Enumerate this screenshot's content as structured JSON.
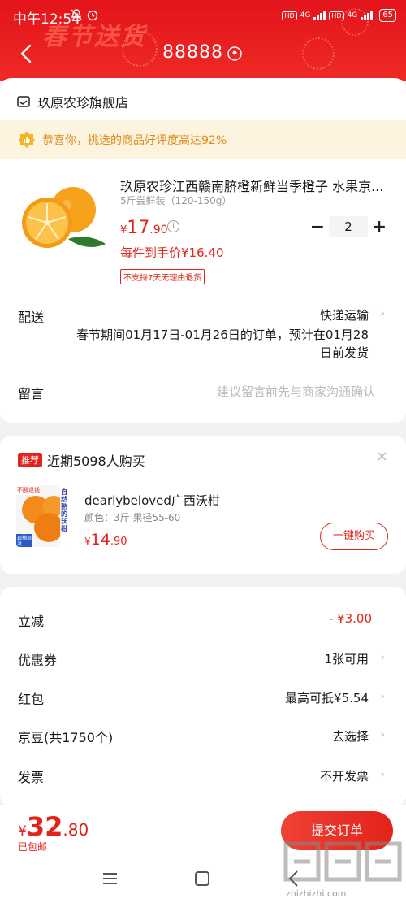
{
  "status_bar": {
    "time": "中午12:54",
    "battery": "65",
    "network": "4G"
  },
  "header": {
    "festival_text": "春节送货",
    "title": "88888"
  },
  "shop": {
    "name": "玖原农珍旗舰店"
  },
  "banner": {
    "text": "恭喜你，挑选的商品好评度高达92%"
  },
  "product": {
    "title": "玖原农珍江西赣南脐橙新鲜当季橙子 水果京...",
    "spec": "5斤尝鲜装（120-150g）",
    "price_currency": "¥",
    "price_int": "17",
    "price_dec": ".90",
    "quantity": "2",
    "unit_price": "每件到手价¥16.40",
    "no_return": "不支持7天无理由退货"
  },
  "delivery": {
    "label": "配送",
    "value": "快递运输",
    "note_line1": "春节期间01月17日-01月26日的订单，预计在01月28",
    "note_line2": "日前发货"
  },
  "remark": {
    "label": "留言",
    "placeholder": "建议留言前先与商家沟通确认"
  },
  "recommend": {
    "badge": "推荐",
    "title": "近期5098人购买",
    "item_name": "dearlybeloved广西沃柑",
    "item_spec": "颜色：3斤  果径55-60",
    "price_currency": "¥",
    "price_int": "14",
    "price_dec": ".90",
    "buy_label": "一键购买",
    "image_text_top": "不酸退钱",
    "image_text_side": "自然熟的沃柑",
    "image_text_bottom": "现摘现发"
  },
  "summary": [
    {
      "label": "立减",
      "value": "- ¥3.00"
    },
    {
      "label": "优惠券",
      "value": "1张可用"
    },
    {
      "label": "红包",
      "value": "最高可抵¥5.54"
    },
    {
      "label": "京豆(共1750个)",
      "value": "去选择"
    },
    {
      "label": "发票",
      "value": "不开发票"
    }
  ],
  "footer": {
    "total_currency": "¥",
    "total_int": "32",
    "total_dec": ".80",
    "shipping": "已包邮",
    "submit_label": "提交订单"
  },
  "watermark": {
    "text": "zhizhizhi.com"
  },
  "colors": {
    "brand_red": "#e2231a",
    "banner_bg": "#fdf4df",
    "banner_text": "#e08a19"
  }
}
